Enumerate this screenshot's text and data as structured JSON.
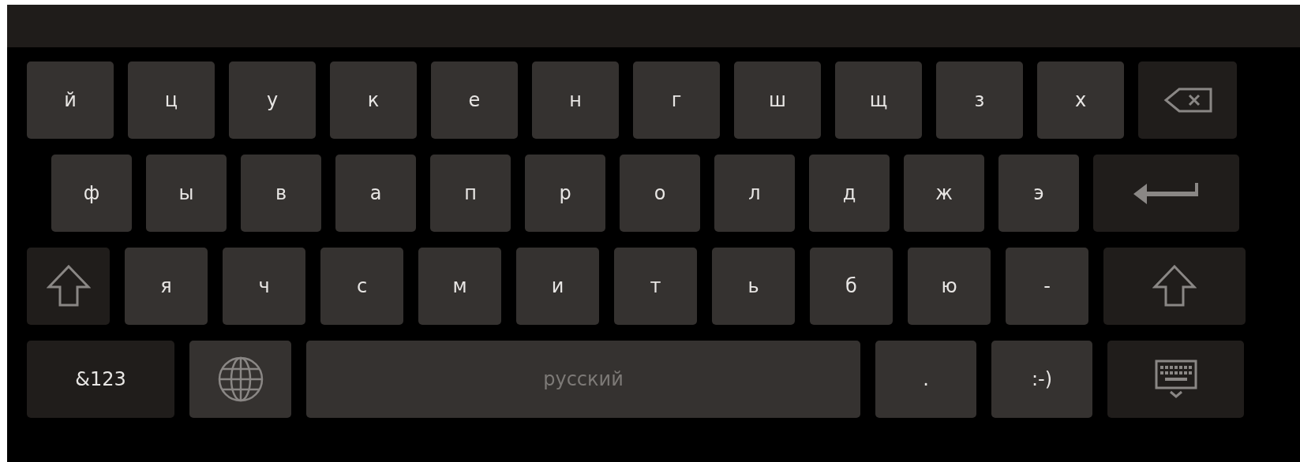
{
  "keyboard": {
    "rows": [
      {
        "keys": [
          {
            "kind": "char",
            "label": "й"
          },
          {
            "kind": "char",
            "label": "ц"
          },
          {
            "kind": "char",
            "label": "у"
          },
          {
            "kind": "char",
            "label": "к"
          },
          {
            "kind": "char",
            "label": "е"
          },
          {
            "kind": "char",
            "label": "н"
          },
          {
            "kind": "char",
            "label": "г"
          },
          {
            "kind": "char",
            "label": "ш"
          },
          {
            "kind": "char",
            "label": "щ"
          },
          {
            "kind": "char",
            "label": "з"
          },
          {
            "kind": "char",
            "label": "х"
          },
          {
            "kind": "backspace"
          }
        ]
      },
      {
        "keys": [
          {
            "kind": "char",
            "label": "ф"
          },
          {
            "kind": "char",
            "label": "ы"
          },
          {
            "kind": "char",
            "label": "в"
          },
          {
            "kind": "char",
            "label": "а"
          },
          {
            "kind": "char",
            "label": "п"
          },
          {
            "kind": "char",
            "label": "р"
          },
          {
            "kind": "char",
            "label": "о"
          },
          {
            "kind": "char",
            "label": "л"
          },
          {
            "kind": "char",
            "label": "д"
          },
          {
            "kind": "char",
            "label": "ж"
          },
          {
            "kind": "char",
            "label": "э"
          },
          {
            "kind": "enter"
          }
        ]
      },
      {
        "keys": [
          {
            "kind": "shift"
          },
          {
            "kind": "char",
            "label": "я"
          },
          {
            "kind": "char",
            "label": "ч"
          },
          {
            "kind": "char",
            "label": "с"
          },
          {
            "kind": "char",
            "label": "м"
          },
          {
            "kind": "char",
            "label": "и"
          },
          {
            "kind": "char",
            "label": "т"
          },
          {
            "kind": "char",
            "label": "ь"
          },
          {
            "kind": "char",
            "label": "б"
          },
          {
            "kind": "char",
            "label": "ю"
          },
          {
            "kind": "char",
            "label": "-"
          },
          {
            "kind": "shift"
          }
        ]
      },
      {
        "keys": [
          {
            "kind": "mode",
            "label": "&123"
          },
          {
            "kind": "globe"
          },
          {
            "kind": "space",
            "label": "русский"
          },
          {
            "kind": "char",
            "label": "."
          },
          {
            "kind": "char",
            "label": ":-)"
          },
          {
            "kind": "hide"
          }
        ]
      }
    ]
  }
}
